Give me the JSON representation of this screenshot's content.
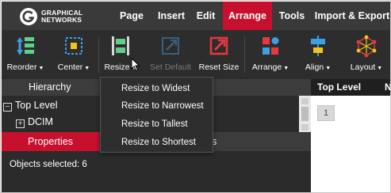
{
  "app": {
    "logo_line1": "GRAPHICAL",
    "logo_line2": "NETWORKS",
    "logo_icon": "gn-logo-icon"
  },
  "menu": {
    "items": [
      {
        "label": "Page",
        "active": false
      },
      {
        "label": "Insert",
        "active": false
      },
      {
        "label": "Edit",
        "active": false
      },
      {
        "label": "Arrange",
        "active": true
      },
      {
        "label": "Tools",
        "active": false
      },
      {
        "label": "Import & Export",
        "active": false
      }
    ]
  },
  "toolbar": {
    "reorder": {
      "label": "Reorder",
      "icon": "reorder-icon",
      "has_menu": true
    },
    "center": {
      "label": "Center",
      "icon": "center-icon",
      "has_menu": true
    },
    "resize": {
      "label": "Resize",
      "icon": "resize-icon",
      "has_menu": true
    },
    "set_default": {
      "label": "Set Default",
      "icon": "set-default-icon",
      "disabled": true
    },
    "reset_size": {
      "label": "Reset Size",
      "icon": "reset-size-icon"
    },
    "arrange": {
      "label": "Arrange",
      "icon": "arrange-icon",
      "has_menu": true
    },
    "align": {
      "label": "Align",
      "icon": "align-icon",
      "has_menu": true
    },
    "layout": {
      "label": "Layout",
      "icon": "layout-icon",
      "has_menu": true
    }
  },
  "resize_menu": {
    "items": [
      "Resize to Widest",
      "Resize to Narrowest",
      "Resize to Tallest",
      "Resize to Shortest"
    ]
  },
  "hierarchy": {
    "title": "Hierarchy",
    "tree": [
      {
        "label": "Top Level",
        "expander": "−"
      },
      {
        "label": "DCIM",
        "expander": "+"
      }
    ]
  },
  "properties": {
    "tab_label": "Properties",
    "tab2_visible_fragment": "s",
    "objects_selected": "Objects selected: 6"
  },
  "right_panel": {
    "header_tab1": "Top Level",
    "header_tab2_fragment": "N",
    "page_number": "1"
  },
  "colors": {
    "accent": "#c8102e",
    "menubar": "#3a3a3a",
    "toolbar": "#2d2d2d",
    "panel": "#2b2b2b",
    "icon_green": "#5fd08a",
    "icon_blue": "#3aa0e8",
    "icon_yellow": "#f2c318",
    "icon_red": "#e8383f"
  }
}
